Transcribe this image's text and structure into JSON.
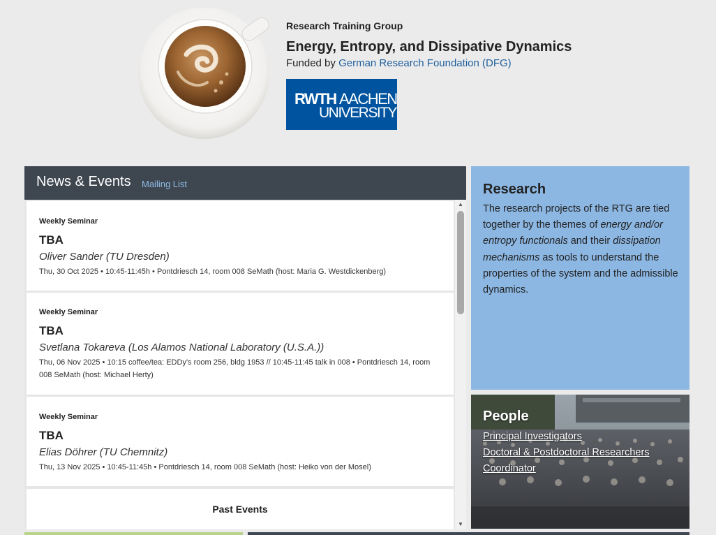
{
  "header": {
    "group_label": "Research Training Group",
    "title": "Energy, Entropy, and Dissipative Dynamics",
    "funded_prefix": "Funded by",
    "funder_link": "German Research Foundation (DFG)",
    "logo": {
      "name": "RWTH Aachen University logo",
      "line1": "RWTH AACHEN",
      "line2": "UNIVERSITY",
      "color": "#00549f"
    },
    "cup_icon": "coffee-cup-logo"
  },
  "news": {
    "title": "News & Events",
    "mailing_list": "Mailing List",
    "events": [
      {
        "type": "Weekly Seminar",
        "title": "TBA",
        "speaker": "Oliver Sander (TU Dresden)",
        "details": "Thu, 30 Oct 2025 • 10:45-11:45h • Pontdriesch 14, room 008 SeMath (host: Maria G. Westdickenberg)"
      },
      {
        "type": "Weekly Seminar",
        "title": "TBA",
        "speaker": "Svetlana Tokareva (Los Alamos National Laboratory (U.S.A.))",
        "details": "Thu, 06 Nov 2025 • 10:15 coffee/tea: EDDy's room 256, bldg 1953 // 10:45-11:45 talk in 008 • Pontdriesch 14, room 008 SeMath (host: Michael Herty)"
      },
      {
        "type": "Weekly Seminar",
        "title": "TBA",
        "speaker": "Elias Döhrer (TU Chemnitz)",
        "details": "Thu, 13 Nov 2025 • 10:45-11:45h • Pontdriesch 14, room 008 SeMath (host: Heiko von der Mosel)"
      }
    ],
    "past_events": "Past Events"
  },
  "research": {
    "title": "Research",
    "text_1": "The research projects of the RTG are tied together by the themes of ",
    "text_em1": "energy and/or entropy functionals",
    "text_2": " and their ",
    "text_em2": "dissipation mechanisms",
    "text_3": " as tools to understand the properties of the system and the admissible dynamics.",
    "color": "#8cb7e3"
  },
  "people": {
    "title": "People",
    "links": [
      "Principal Investigators",
      "Doctoral & Postdoctoral Researchers",
      "Coordinator"
    ]
  },
  "colors": {
    "background": "#ebebeb",
    "news_header": "#3e4650",
    "link": "#1f5f9e",
    "accent_green": "#b9d48a"
  }
}
